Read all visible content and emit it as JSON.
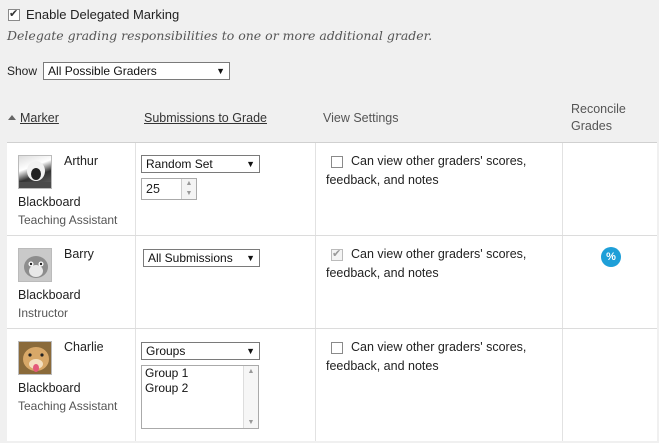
{
  "enable": {
    "label": "Enable Delegated Marking",
    "checked": true
  },
  "description": "Delegate grading responsibilities to one or more additional grader.",
  "show": {
    "label": "Show",
    "selected": "All Possible Graders"
  },
  "columns": {
    "marker": "Marker",
    "submissions": "Submissions to Grade",
    "view": "View Settings",
    "reconcile_line1": "Reconcile",
    "reconcile_line2": "Grades"
  },
  "rows": [
    {
      "first": "Arthur",
      "last": "Blackboard",
      "role": "Teaching Assistant",
      "submissions": "Random Set",
      "count": "25",
      "view_line1": "Can view other graders' scores,",
      "view_line2": "feedback, and notes",
      "view_checked": false,
      "reconcile": false
    },
    {
      "first": "Barry",
      "last": "Blackboard",
      "role": "Instructor",
      "submissions": "All Submissions",
      "view_line1": "Can view other graders' scores,",
      "view_line2": "feedback, and notes",
      "view_checked": true,
      "reconcile": true,
      "reconcile_icon": "reconcile-grades-icon"
    },
    {
      "first": "Charlie",
      "last": "Blackboard",
      "role": "Teaching Assistant",
      "submissions": "Groups",
      "groups": [
        "Group 1",
        "Group 2"
      ],
      "view_line1": "Can view other graders' scores,",
      "view_line2": "feedback, and notes",
      "view_checked": false,
      "reconcile": false
    }
  ],
  "colors": {
    "accent": "#1e9fd8",
    "background": "#f0f0f0",
    "table": "#ffffff"
  }
}
